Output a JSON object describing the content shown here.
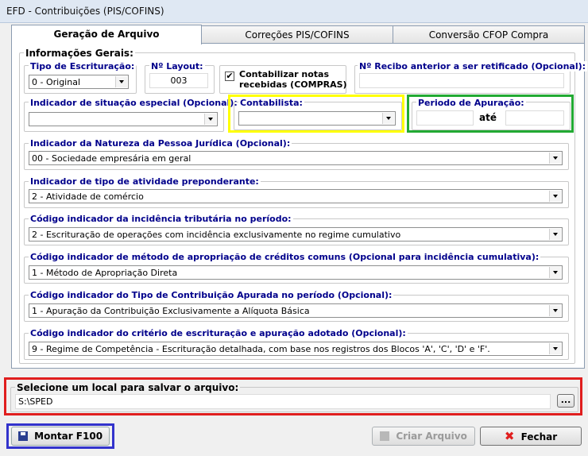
{
  "window": {
    "title": "EFD - Contribuições (PIS/COFINS)"
  },
  "tabs": [
    {
      "label": "Geração de Arquivo"
    },
    {
      "label": "Correções PIS/COFINS"
    },
    {
      "label": "Conversão CFOP Compra"
    }
  ],
  "general": {
    "section_label": "Informações Gerais:",
    "tipo_escrituracao": {
      "label": "Tipo de Escrituração:",
      "value": "0 - Original"
    },
    "layout": {
      "label": "Nº Layout:",
      "value": "003"
    },
    "contabilizar": {
      "label_line1": "Contabilizar notas",
      "label_line2": "recebidas (COMPRAS)",
      "checked": true
    },
    "recibo": {
      "label": "Nº Recibo anterior a ser retificado (Opcional):",
      "value": ""
    },
    "situacao_especial": {
      "label": "Indicador de situação especial (Opcional):",
      "value": ""
    },
    "contabilista": {
      "label": "Contabilista:",
      "value": ""
    },
    "periodo": {
      "label": "Periodo de Apuração:",
      "separator": "até"
    }
  },
  "indicators": [
    {
      "label": "Indicador da Natureza da Pessoa Jurídica (Opcional):",
      "value": "00 - Sociedade empresária em geral"
    },
    {
      "label": "Indicador de tipo de atividade preponderante:",
      "value": "2 - Atividade de comércio"
    },
    {
      "label": "Código indicador da incidência tributária no período:",
      "value": "2 - Escrituração de operações com incidência exclusivamente no regime cumulativo"
    },
    {
      "label": "Código indicador de método de apropriação de créditos comuns (Opcional para incidência cumulativa):",
      "value": "1 - Método de Apropriação Direta"
    },
    {
      "label": "Código indicador do Tipo de Contribuição Apurada no período (Opcional):",
      "value": "1 - Apuração da Contribuição Exclusivamente a Alíquota Básica"
    },
    {
      "label": "Código indicador do critério de escrituração e apuração adotado (Opcional):",
      "value": "9 - Regime de Competência - Escrituração detalhada, com base nos registros dos Blocos 'A', 'C', 'D' e 'F'."
    }
  ],
  "save": {
    "label": "Selecione um local para salvar o arquivo:",
    "path": "S:\\SPED",
    "browse_label": "..."
  },
  "buttons": {
    "montar": "Montar F100",
    "criar": "Criar Arquivo",
    "fechar": "Fechar"
  },
  "highlights": {
    "contabilista": "#ffff00",
    "periodo": "#22aa33",
    "save": "#e01e1e",
    "montar": "#3333cc"
  }
}
